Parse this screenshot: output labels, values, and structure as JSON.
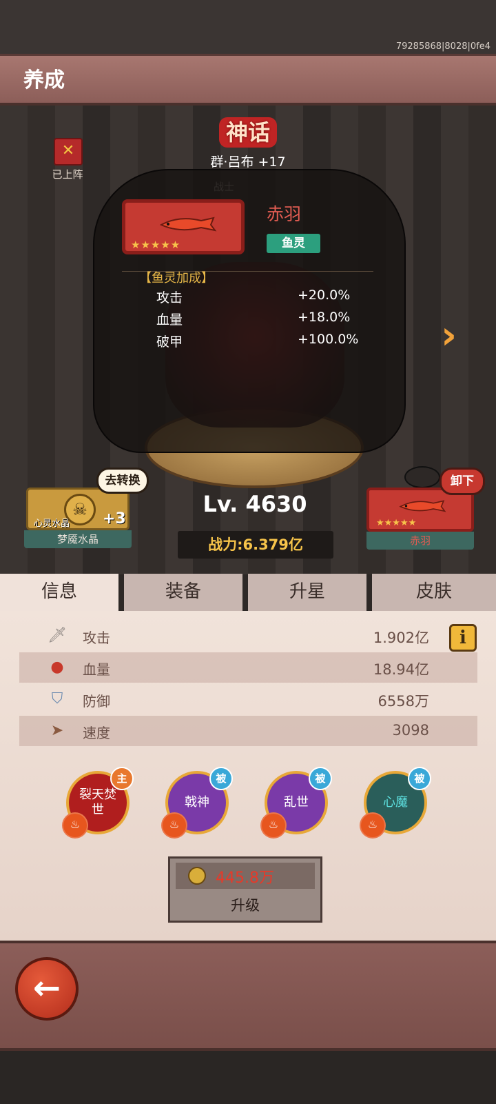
{
  "build_id": "79285868|8028|0fe4",
  "header": {
    "title": "养成"
  },
  "hero": {
    "rarity": "神话",
    "name": "群·吕布 +17",
    "class": "战士",
    "deployed_label": "已上阵",
    "level": "Lv. 4630",
    "power": "战力:6.379亿"
  },
  "pet_popup": {
    "name": "赤羽",
    "tag": "鱼灵",
    "stars": "★★★★★",
    "bonus_title": "【鱼灵加成】",
    "bonuses": [
      {
        "label": "攻击",
        "value": "+20.0%"
      },
      {
        "label": "血量",
        "value": "+18.0%"
      },
      {
        "label": "破甲",
        "value": "+100.0%"
      }
    ]
  },
  "crystal": {
    "bubble": "去转换",
    "sub_label": "心灵水晶",
    "plus": "+3",
    "name": "梦魇水晶"
  },
  "pet_slot": {
    "bubble": "卸下",
    "name": "赤羽",
    "stars": "★★★★★"
  },
  "tabs": [
    "信息",
    "装备",
    "升星",
    "皮肤"
  ],
  "stats": [
    {
      "icon": "sword-icon",
      "label": "攻击",
      "value": "1.902亿"
    },
    {
      "icon": "blood-drop-icon",
      "label": "血量",
      "value": "18.94亿"
    },
    {
      "icon": "shield-icon",
      "label": "防御",
      "value": "6558万"
    },
    {
      "icon": "boot-icon",
      "label": "速度",
      "value": "3098"
    }
  ],
  "skills": [
    {
      "name": "裂天焚世",
      "badge": "主",
      "ring": "#e8a838",
      "bg": "#b01e1e",
      "badge_color": "#e8782e"
    },
    {
      "name": "戟神",
      "badge": "被",
      "ring": "#e8a838",
      "bg": "#7a3aa8",
      "badge_color": "#3aa8d8"
    },
    {
      "name": "乱世",
      "badge": "被",
      "ring": "#e8a838",
      "bg": "#7a3aa8",
      "badge_color": "#3aa8d8"
    },
    {
      "name": "心魔",
      "badge": "被",
      "ring": "#e8a838",
      "bg": "#2a5e5a",
      "badge_color": "#3aa8d8"
    }
  ],
  "upgrade": {
    "cost": "445.8万",
    "label": "升级"
  },
  "colors": {
    "accent_gold": "#f7c44a",
    "pet_red": "#c53a32",
    "tag_green": "#2c9f7e"
  }
}
